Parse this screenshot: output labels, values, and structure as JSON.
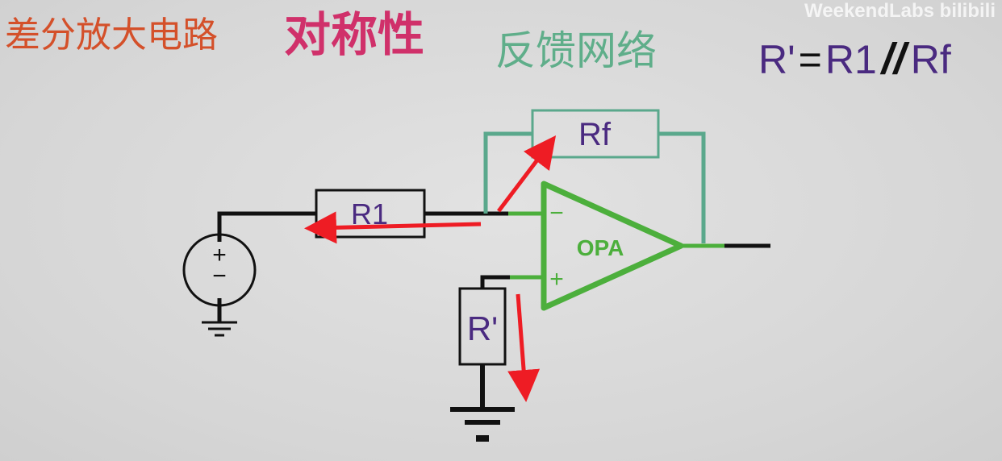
{
  "title": {
    "part1": "差分放大电路",
    "part2": "对称性",
    "part3": "反馈网络"
  },
  "watermark": "WeekendLabs bilibili",
  "formula": {
    "lhs": "R'",
    "eq": "=",
    "r1": "R1",
    "parallel": "//",
    "rf": "Rf"
  },
  "diagram": {
    "rf_label": "Rf",
    "r1_label": "R1",
    "rprime_label": "R'",
    "opamp_label": "OPA",
    "minus_sign": "−",
    "plus_sign": "+",
    "source_symbol_plus": "+",
    "source_symbol_minus": "−"
  },
  "colors": {
    "title1": "#d4502a",
    "title2": "#d0306a",
    "title3": "#5fae8a",
    "formula": "#4a2a80",
    "wire": "#111111",
    "feedback": "#5aa88c",
    "opamp": "#4caf3c",
    "arrow": "#ee1c24",
    "label": "#4a2a80"
  }
}
